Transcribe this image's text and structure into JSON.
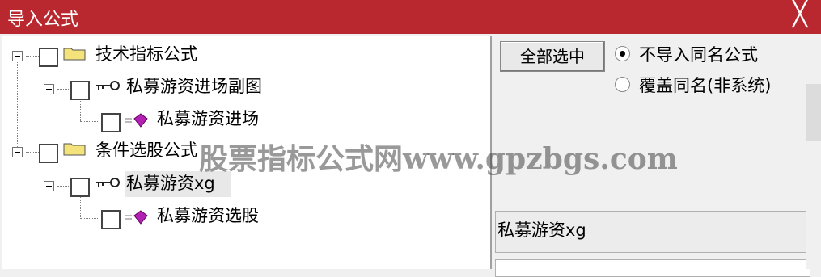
{
  "window": {
    "title": "导入公式",
    "close_glyph": "╳"
  },
  "tree": {
    "groups": [
      {
        "label": "技术指标公式",
        "children": [
          {
            "label": "私募游资进场副图",
            "leaf": "私募游资进场"
          }
        ]
      },
      {
        "label": "条件选股公式",
        "children": [
          {
            "label": "私募游资xg",
            "leaf": "私募游资选股"
          }
        ]
      }
    ]
  },
  "right": {
    "select_all_label": "全部选中",
    "options": [
      {
        "label": "不导入同名公式",
        "selected": true
      },
      {
        "label": "覆盖同名(非系统)",
        "selected": false
      }
    ],
    "selected_name": "私募游资xg"
  },
  "watermark": "股票指标公式网www.gpzbgs.com",
  "colors": {
    "titlebar": "#b8282e",
    "folder": "#f4e27a",
    "gem": "#b321b3"
  }
}
